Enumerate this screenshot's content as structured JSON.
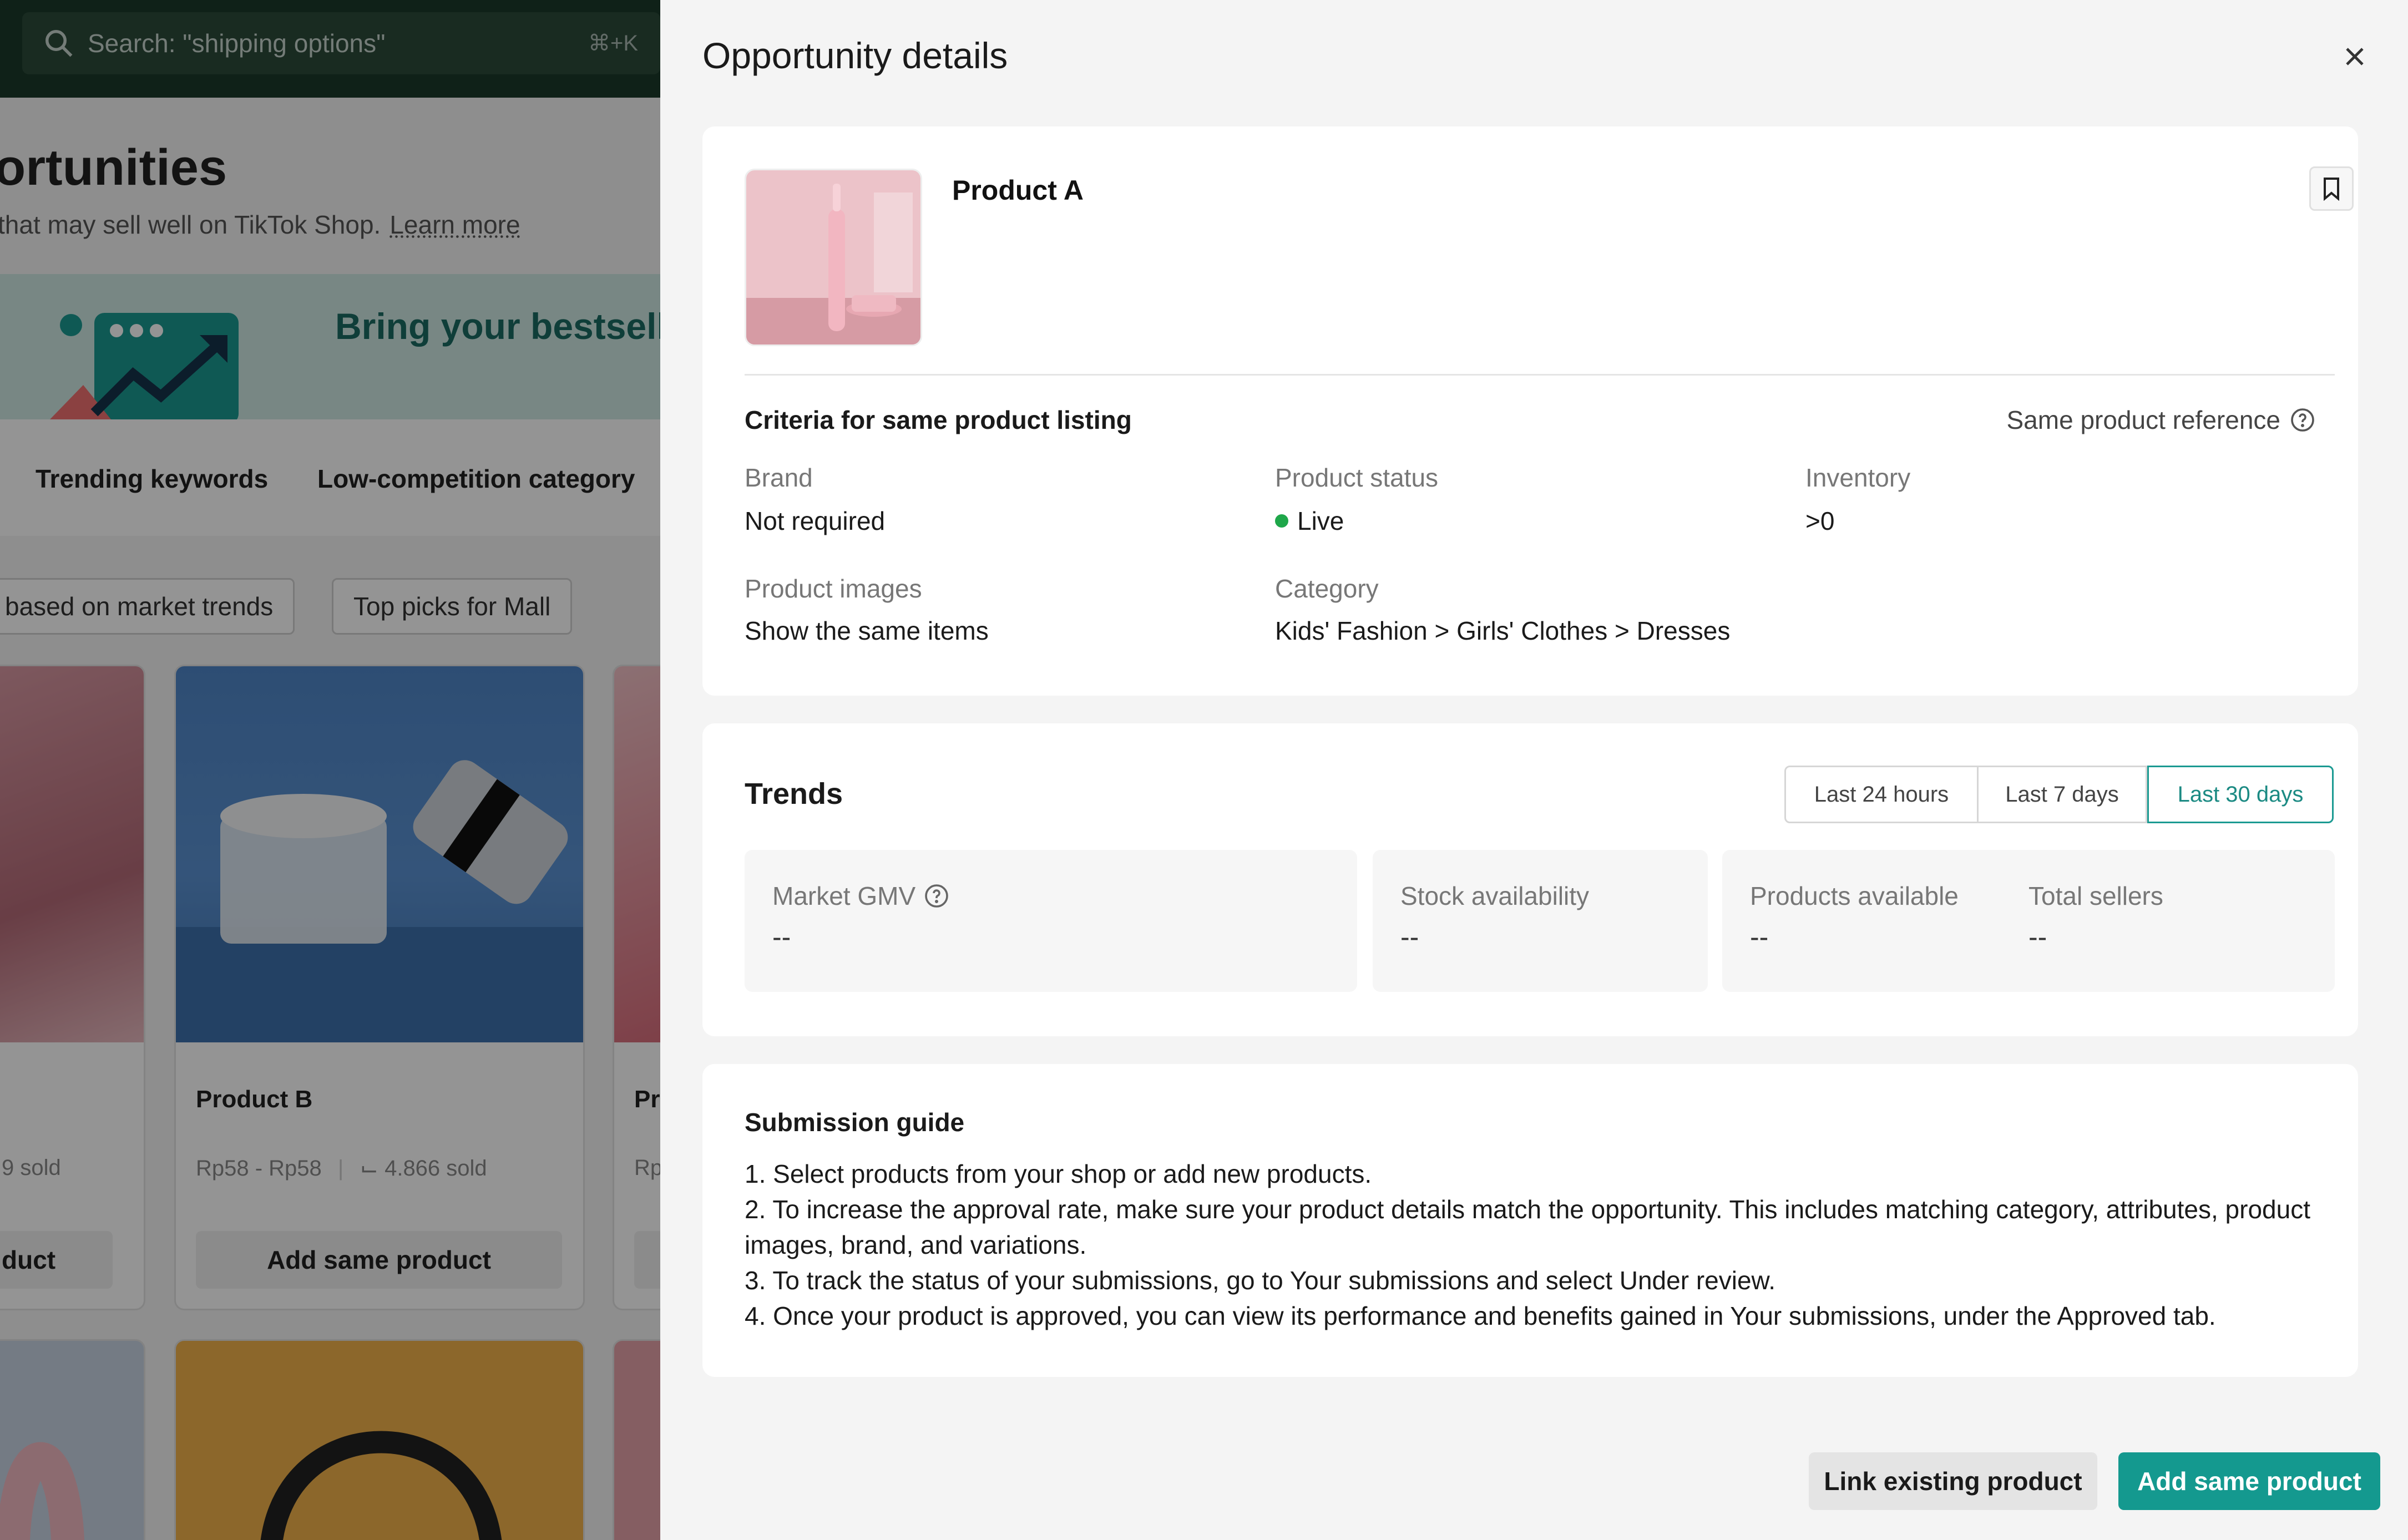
{
  "background": {
    "search": {
      "placeholder": "Search: \"shipping options\"",
      "shortcut": "⌘+K"
    },
    "page_title": "ortunities",
    "page_subtitle": "that may sell well on TikTok Shop.",
    "learn_more": "Learn more",
    "banner_headline": "Bring your bestsell",
    "tabs": [
      "Trending keywords",
      "Low-competition category"
    ],
    "chips": [
      "based on market trends",
      "Top picks for Mall"
    ],
    "cards": [
      {
        "meta": "9 sold",
        "button": "duct"
      },
      {
        "name": "Product B",
        "price": "Rp58 - Rp58",
        "sold": "4.866 sold",
        "button": "Add same product"
      },
      {
        "name": "Pro",
        "meta": "Rp"
      }
    ]
  },
  "drawer": {
    "title": "Opportunity details",
    "product_name": "Product A",
    "criteria": {
      "title": "Criteria for same product listing",
      "reference_link": "Same product reference",
      "brand": {
        "label": "Brand",
        "value": "Not required"
      },
      "status": {
        "label": "Product status",
        "value": "Live",
        "color": "#1fa74a"
      },
      "inventory": {
        "label": "Inventory",
        "value": ">0"
      },
      "images": {
        "label": "Product images",
        "value": "Show the same items"
      },
      "category": {
        "label": "Category",
        "value": "Kids' Fashion > Girls' Clothes > Dresses"
      }
    },
    "trends": {
      "title": "Trends",
      "ranges": [
        "Last 24 hours",
        "Last 7 days",
        "Last 30 days"
      ],
      "selected_range": "Last 30 days",
      "stats": {
        "market_gmv": {
          "label": "Market GMV",
          "value": "--"
        },
        "stock": {
          "label": "Stock availability",
          "value": "--"
        },
        "products": {
          "label": "Products available",
          "value": "--"
        },
        "sellers": {
          "label": "Total sellers",
          "value": "--"
        }
      }
    },
    "guide": {
      "title": "Submission guide",
      "steps": [
        "1. Select products from your shop or add new products.",
        "2. To increase the approval rate, make sure your product details match the opportunity. This includes matching category, attributes, product images, brand, and variations.",
        "3. To track the status of your submissions, go to Your submissions and select Under review.",
        "4. Once your product is approved, you can view its performance and benefits gained in Your submissions, under the Approved tab."
      ]
    },
    "footer": {
      "link_existing": "Link existing product",
      "add_same": "Add same product"
    },
    "accent_color": "#14998f"
  }
}
